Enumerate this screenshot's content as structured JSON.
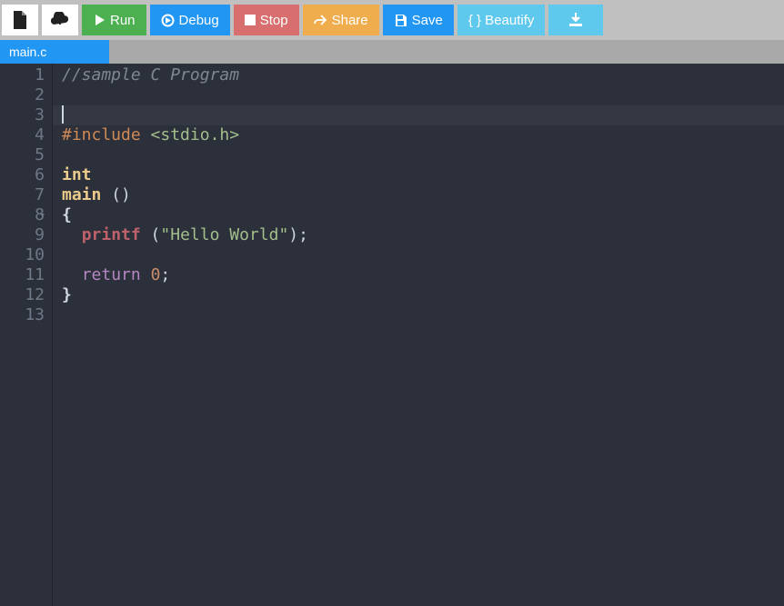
{
  "toolbar": {
    "run_label": "Run",
    "debug_label": "Debug",
    "stop_label": "Stop",
    "share_label": "Share",
    "save_label": "Save",
    "beautify_label": "{ } Beautify"
  },
  "tabs": [
    {
      "label": "main.c"
    }
  ],
  "editor": {
    "active_line": 3,
    "lines": [
      {
        "n": 1,
        "tokens": [
          {
            "t": "//sample C Program",
            "c": "c-comment"
          }
        ]
      },
      {
        "n": 2,
        "tokens": []
      },
      {
        "n": 3,
        "tokens": [],
        "cursor": true
      },
      {
        "n": 4,
        "tokens": [
          {
            "t": "#include",
            "c": "c-preproc"
          },
          {
            "t": " ",
            "c": "c-punct"
          },
          {
            "t": "<stdio.h>",
            "c": "c-include"
          }
        ]
      },
      {
        "n": 5,
        "tokens": []
      },
      {
        "n": 6,
        "tokens": [
          {
            "t": "int",
            "c": "c-type"
          }
        ]
      },
      {
        "n": 7,
        "tokens": [
          {
            "t": "main",
            "c": "c-type"
          },
          {
            "t": " ",
            "c": "c-punct"
          },
          {
            "t": "()",
            "c": "c-punct"
          }
        ]
      },
      {
        "n": 8,
        "fold": true,
        "tokens": [
          {
            "t": "{",
            "c": "c-brace"
          }
        ]
      },
      {
        "n": 9,
        "tokens": [
          {
            "t": "  ",
            "c": "c-punct"
          },
          {
            "t": "printf",
            "c": "c-func"
          },
          {
            "t": " (",
            "c": "c-punct"
          },
          {
            "t": "\"Hello World\"",
            "c": "c-string"
          },
          {
            "t": ");",
            "c": "c-punct"
          }
        ]
      },
      {
        "n": 10,
        "tokens": []
      },
      {
        "n": 11,
        "tokens": [
          {
            "t": "  ",
            "c": "c-punct"
          },
          {
            "t": "return",
            "c": "c-keyword"
          },
          {
            "t": " ",
            "c": "c-punct"
          },
          {
            "t": "0",
            "c": "c-number"
          },
          {
            "t": ";",
            "c": "c-punct"
          }
        ]
      },
      {
        "n": 12,
        "tokens": [
          {
            "t": "}",
            "c": "c-brace"
          }
        ]
      },
      {
        "n": 13,
        "tokens": []
      }
    ]
  }
}
